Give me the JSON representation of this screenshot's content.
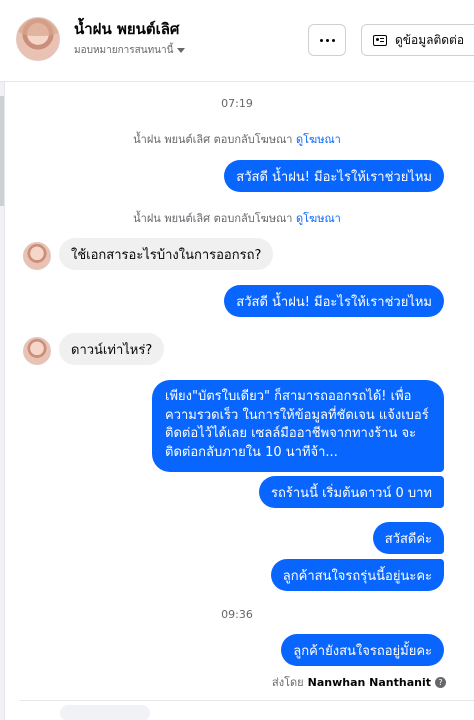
{
  "header": {
    "name": "น้ำฝน พยนต์เลิศ",
    "subtitle": "มอบหมายการสนทนานี้",
    "contact_label": "ดูข้อมูลติดต่อ"
  },
  "timestamps": [
    "07:19",
    "09:36"
  ],
  "system_notes": [
    {
      "text": "น้ำฝน พยนต์เลิศ ตอบกลับโฆษณา",
      "link": "ดูโฆษณา"
    },
    {
      "text": "น้ำฝน พยนต์เลิศ ตอบกลับโฆษณา",
      "link": "ดูโฆษณา"
    }
  ],
  "messages": [
    {
      "from": "page",
      "text": "สวัสดี น้ำฝน! มีอะไรให้เราช่วยไหม"
    },
    {
      "from": "customer",
      "text": "ใช้เอกสารอะไรบ้างในการออกรถ?"
    },
    {
      "from": "page",
      "text": "สวัสดี น้ำฝน! มีอะไรให้เราช่วยไหม"
    },
    {
      "from": "customer",
      "text": "ดาวน์เท่าไหร่?"
    },
    {
      "from": "page",
      "text": "เพียง\"บัตรใบเดียว\" ก็สามารถออกรถได้! เพื่อความรวดเร็ว ในการให้ข้อมูลที่ชัดเจน แจ้งเบอร์ติดต่อไว้ได้เลย เซลล์มืออาชีพจากทางร้าน จะติดต่อกลับภายใน 10 นาทีจ้า..."
    },
    {
      "from": "page",
      "text": "รถร้านนี้ เริ่มต้นดาวน์ 0 บาท"
    },
    {
      "from": "page",
      "text": "สวัสดีค่ะ"
    },
    {
      "from": "page",
      "text": "ลูกค้าสนใจรถรุ่นนี้อยู่นะคะ"
    },
    {
      "from": "page",
      "text": "ลูกค้ายังสนใจรถอยู่มั้ยคะ"
    }
  ],
  "sent_by": {
    "prefix": "ส่งโดย",
    "name": "Nanwhan Nanthanit"
  }
}
